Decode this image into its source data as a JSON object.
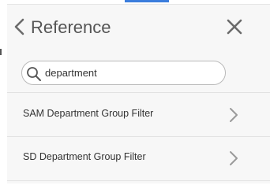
{
  "header": {
    "title": "Reference",
    "back_icon": "chevron-left-icon",
    "close_icon": "close-icon"
  },
  "search": {
    "value": "department",
    "icon": "search-icon"
  },
  "results": [
    {
      "label": "SAM Department Group Filter",
      "icon": "chevron-right-icon"
    },
    {
      "label": "SD Department Group Filter",
      "icon": "chevron-right-icon"
    }
  ],
  "colors": {
    "accent": "#3b7ddd",
    "panel_bg": "#f7f7f7",
    "text": "#333333",
    "icon": "#888888"
  }
}
